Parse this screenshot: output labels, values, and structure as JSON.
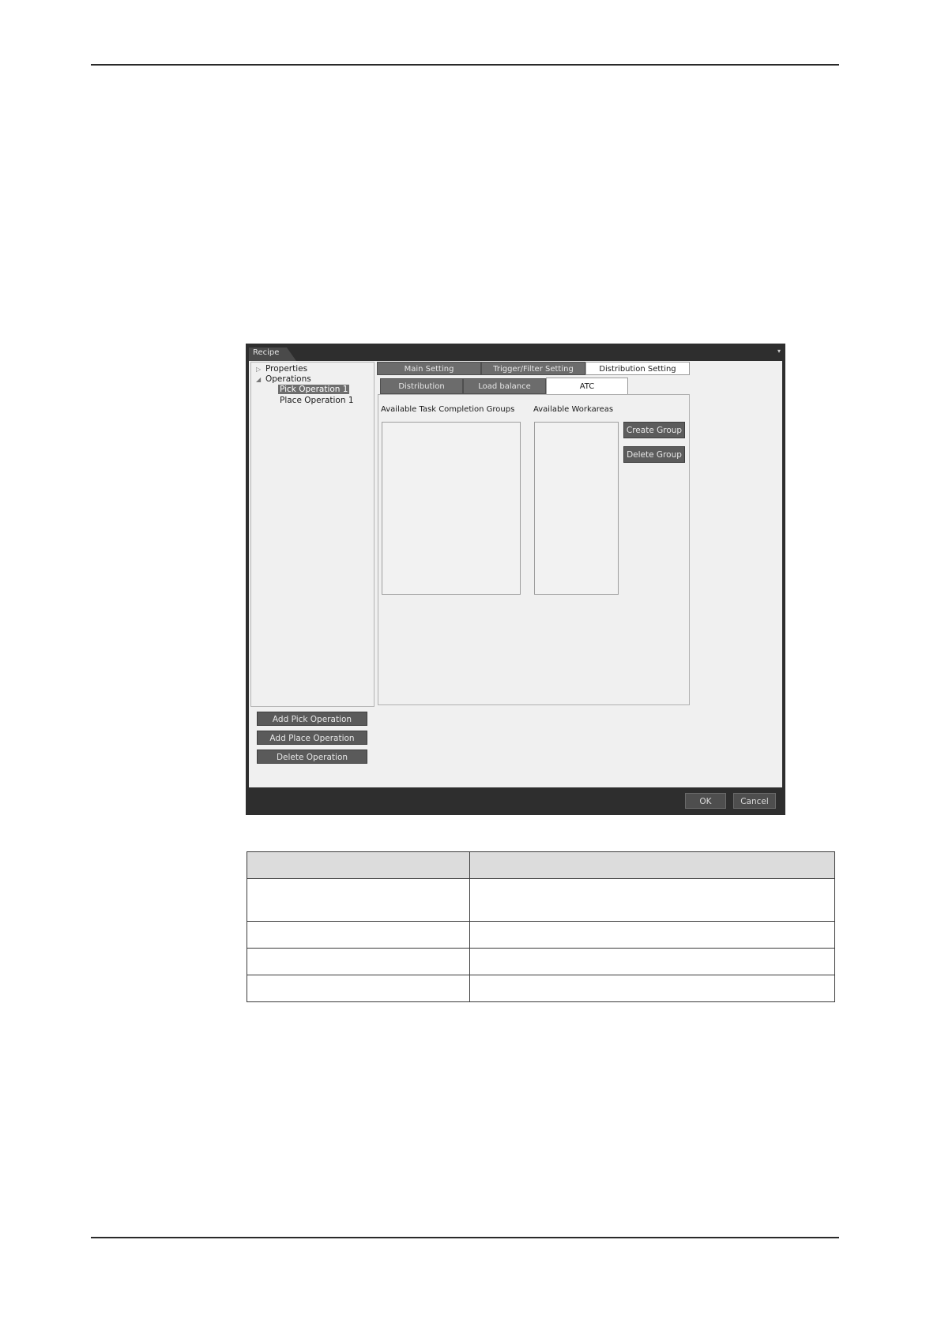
{
  "dialog": {
    "title": "Recipe",
    "menu_arrow": "▾",
    "tree": {
      "properties": "Properties",
      "operations": "Operations",
      "children": [
        "Pick Operation 1",
        "Place Operation 1"
      ]
    },
    "tabs_main": [
      "Main Setting",
      "Trigger/Filter Setting",
      "Distribution Setting"
    ],
    "tabs_sub": [
      "Distribution",
      "Load balance",
      "ATC"
    ],
    "labels": {
      "groups": "Available Task Completion Groups",
      "workareas": "Available Workareas"
    },
    "buttons": {
      "create_group": "Create Group",
      "delete_group": "Delete Group",
      "add_pick": "Add Pick Operation",
      "add_place": "Add Place Operation",
      "delete_operation": "Delete Operation",
      "ok": "OK",
      "cancel": "Cancel"
    }
  },
  "table": {
    "headers": [
      "",
      ""
    ],
    "rows": [
      [
        "",
        ""
      ],
      [
        "",
        ""
      ],
      [
        "",
        ""
      ],
      [
        "",
        ""
      ]
    ]
  }
}
